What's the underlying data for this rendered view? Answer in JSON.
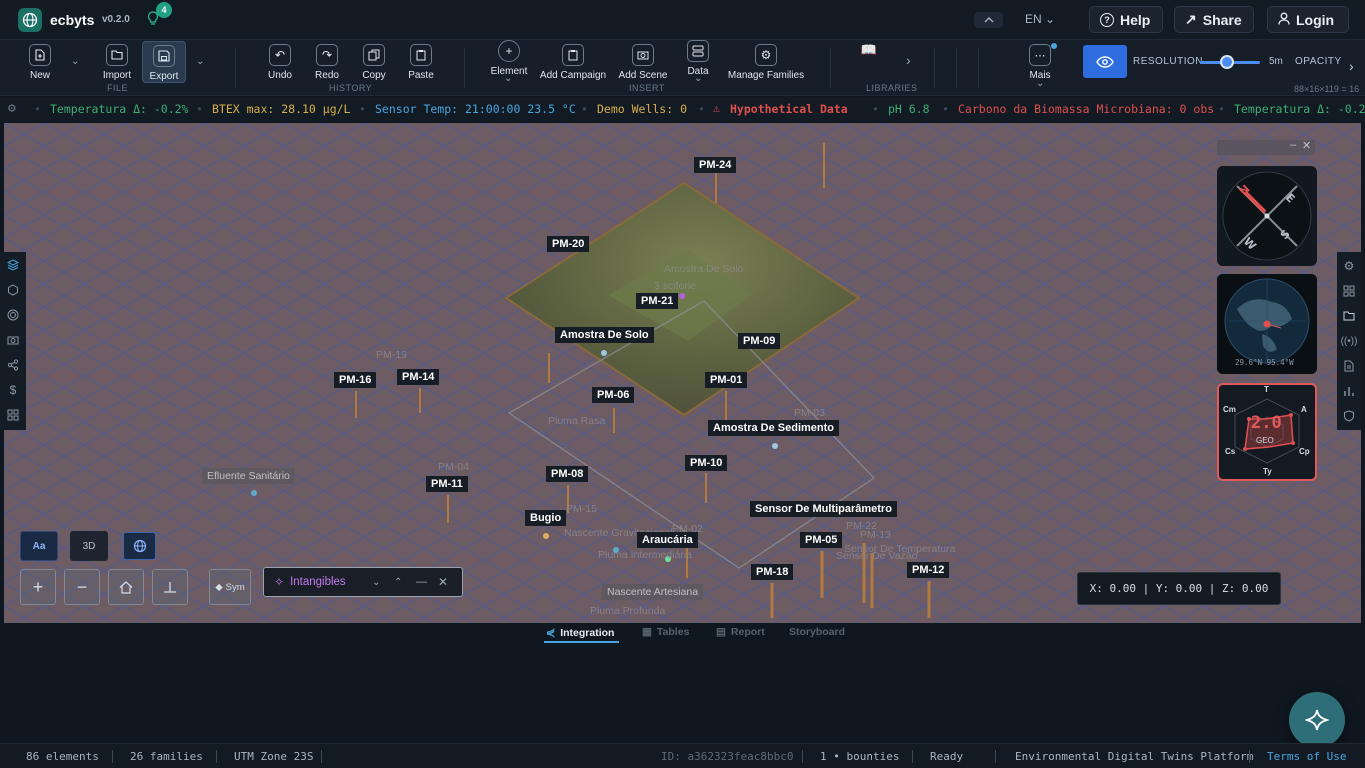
{
  "header": {
    "app_name": "ecbyts",
    "version": "v0.2.0",
    "notification_count": "4",
    "language": "EN",
    "help_label": "Help",
    "share_label": "Share",
    "login_label": "Login"
  },
  "toolbar": {
    "new_label": "New",
    "import_label": "Import",
    "export_label": "Export",
    "file_group": "FILE",
    "undo_label": "Undo",
    "redo_label": "Redo",
    "copy_label": "Copy",
    "paste_label": "Paste",
    "history_group": "HISTORY",
    "element_label": "Element",
    "add_campaign_label": "Add Campaign",
    "add_scene_label": "Add Scene",
    "data_label": "Data",
    "manage_families_label": "Manage Families",
    "insert_group": "INSERT",
    "libraries_group": "LIBRARIES",
    "more_label": "Mais",
    "resolution_label": "RESOLUTION",
    "resolution_value": "5m",
    "opacity_label": "OPACITY",
    "grid_info": "88×16×119 = 16"
  },
  "status_ticker": [
    {
      "text": "Temperatura Δ: -0.2%",
      "color": "#3fae74"
    },
    {
      "text": "BTEX max: 28.10 μg/L",
      "color": "#d8b04a"
    },
    {
      "text": "Sensor Temp: 21:00:00 23.5 °C",
      "color": "#4aa6e0"
    },
    {
      "text": "Demo Wells: 0",
      "color": "#d8b04a"
    },
    {
      "text": "Hypothetical Data",
      "color": "#e0504e"
    },
    {
      "text": "pH 6.8",
      "color": "#3fae74"
    },
    {
      "text": "Carbono da Biomassa Microbiana: 0 obs",
      "color": "#e0504e"
    },
    {
      "text": "Temperatura Δ: -0.2%",
      "color": "#3fae74"
    }
  ],
  "scene_labels": [
    "PM-24",
    "PM-20",
    "PM-21",
    "Amostra De Solo",
    "PM-09",
    "PM-16",
    "PM-14",
    "PM-06",
    "PM-01",
    "Amostra De Sedimento",
    "PM-10",
    "PM-08",
    "PM-11",
    "Bugio",
    "Araucária",
    "Sensor De Multiparâmetro",
    "PM-05",
    "PM-18",
    "PM-12",
    "Efluente Sanitário",
    "Nascente Artesiana"
  ],
  "faint_labels": [
    "Amostra De Solo",
    "3.sciforie",
    "PM-19",
    "PM-03",
    "Pluma Rasa",
    "PM-04",
    "PM-15",
    "PM-02",
    "Nascente Gravitacional",
    "Pluma Intermediária",
    "PM-22",
    "PM-13",
    "Sensor De Temperatura",
    "Sensor De Vazão",
    "Pluma Profunda"
  ],
  "viewport_controls": {
    "aa_label": "Aa",
    "three_d_label": "3D",
    "sym_label": "Sym",
    "intangibles_label": "Intangibles",
    "coords": "X: 0.00 | Y: 0.00 | Z: 0.00"
  },
  "minimap": {
    "globe_coords": "29.6°N 95.4°W",
    "radar_value": "2.0",
    "radar_sub": "GEO",
    "radar_axes": [
      "T",
      "A",
      "Cp",
      "Ty",
      "Cs",
      "Cm"
    ]
  },
  "bottom_tabs": [
    "Integration",
    "Tables",
    "Report",
    "Storyboard"
  ],
  "footer": {
    "elements": "86 elements",
    "families": "26 families",
    "zone": "UTM Zone 23S",
    "id": "ID: a362323feac8bbc0",
    "bounties": "1 • bounties",
    "status": "Ready",
    "platform": "Environmental Digital Twins Platform",
    "terms": "Terms of Use"
  },
  "colors": {
    "accent": "#2d6de0",
    "teal": "#22a085",
    "alert": "#e0504e"
  }
}
